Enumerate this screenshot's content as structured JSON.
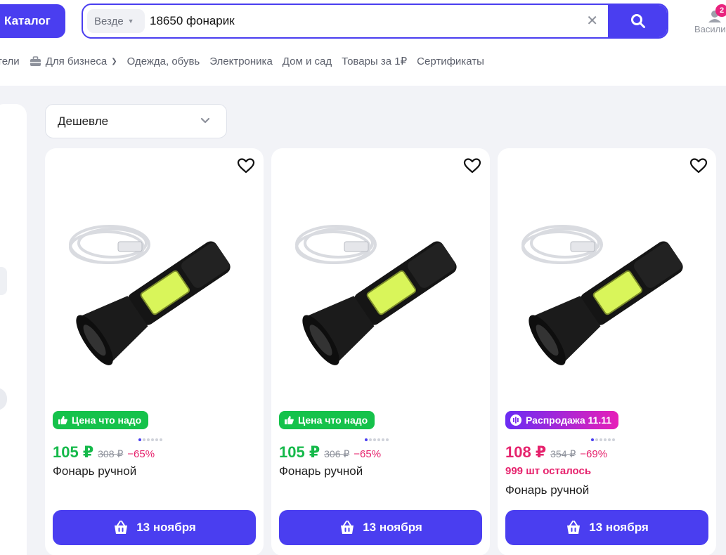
{
  "header": {
    "catalog_label": "Каталог",
    "search": {
      "scope": "Везде",
      "value": "18650 фонарик"
    },
    "user": {
      "badge_count": "2",
      "name": "Васили"
    }
  },
  "nav": {
    "items": [
      {
        "label": "тели"
      },
      {
        "label": "Для бизнеса"
      },
      {
        "label": "Одежда, обувь"
      },
      {
        "label": "Электроника"
      },
      {
        "label": "Дом и сад"
      },
      {
        "label": "Товары за 1₽"
      },
      {
        "label": "Сертификаты"
      }
    ]
  },
  "sort": {
    "selected": "Дешевле"
  },
  "products": [
    {
      "promo": "Цена что надо",
      "promo_style": "green",
      "price": "105 ₽",
      "old_price": "308 ₽",
      "discount": "−65%",
      "stock": "",
      "title": "Фонарь ручной",
      "cart_label": "13 ноября"
    },
    {
      "promo": "Цена что надо",
      "promo_style": "green",
      "price": "105 ₽",
      "old_price": "306 ₽",
      "discount": "−65%",
      "stock": "",
      "title": "Фонарь ручной",
      "cart_label": "13 ноября"
    },
    {
      "promo": "Распродажа 11.11",
      "promo_style": "sale",
      "price": "108 ₽",
      "old_price": "354 ₽",
      "discount": "−69%",
      "stock": "999 шт осталось",
      "title": "Фонарь ручной",
      "cart_label": "13 ноября"
    }
  ],
  "colors": {
    "accent": "#4a3ef0",
    "green": "#15c24b",
    "pink": "#e6236d",
    "background": "#f2f3f7"
  },
  "icons": [
    "search-icon",
    "clear-icon",
    "heart-icon",
    "cart-icon",
    "like-icon",
    "sale-icon",
    "chevron-down-icon",
    "briefcase-icon",
    "user-icon"
  ]
}
